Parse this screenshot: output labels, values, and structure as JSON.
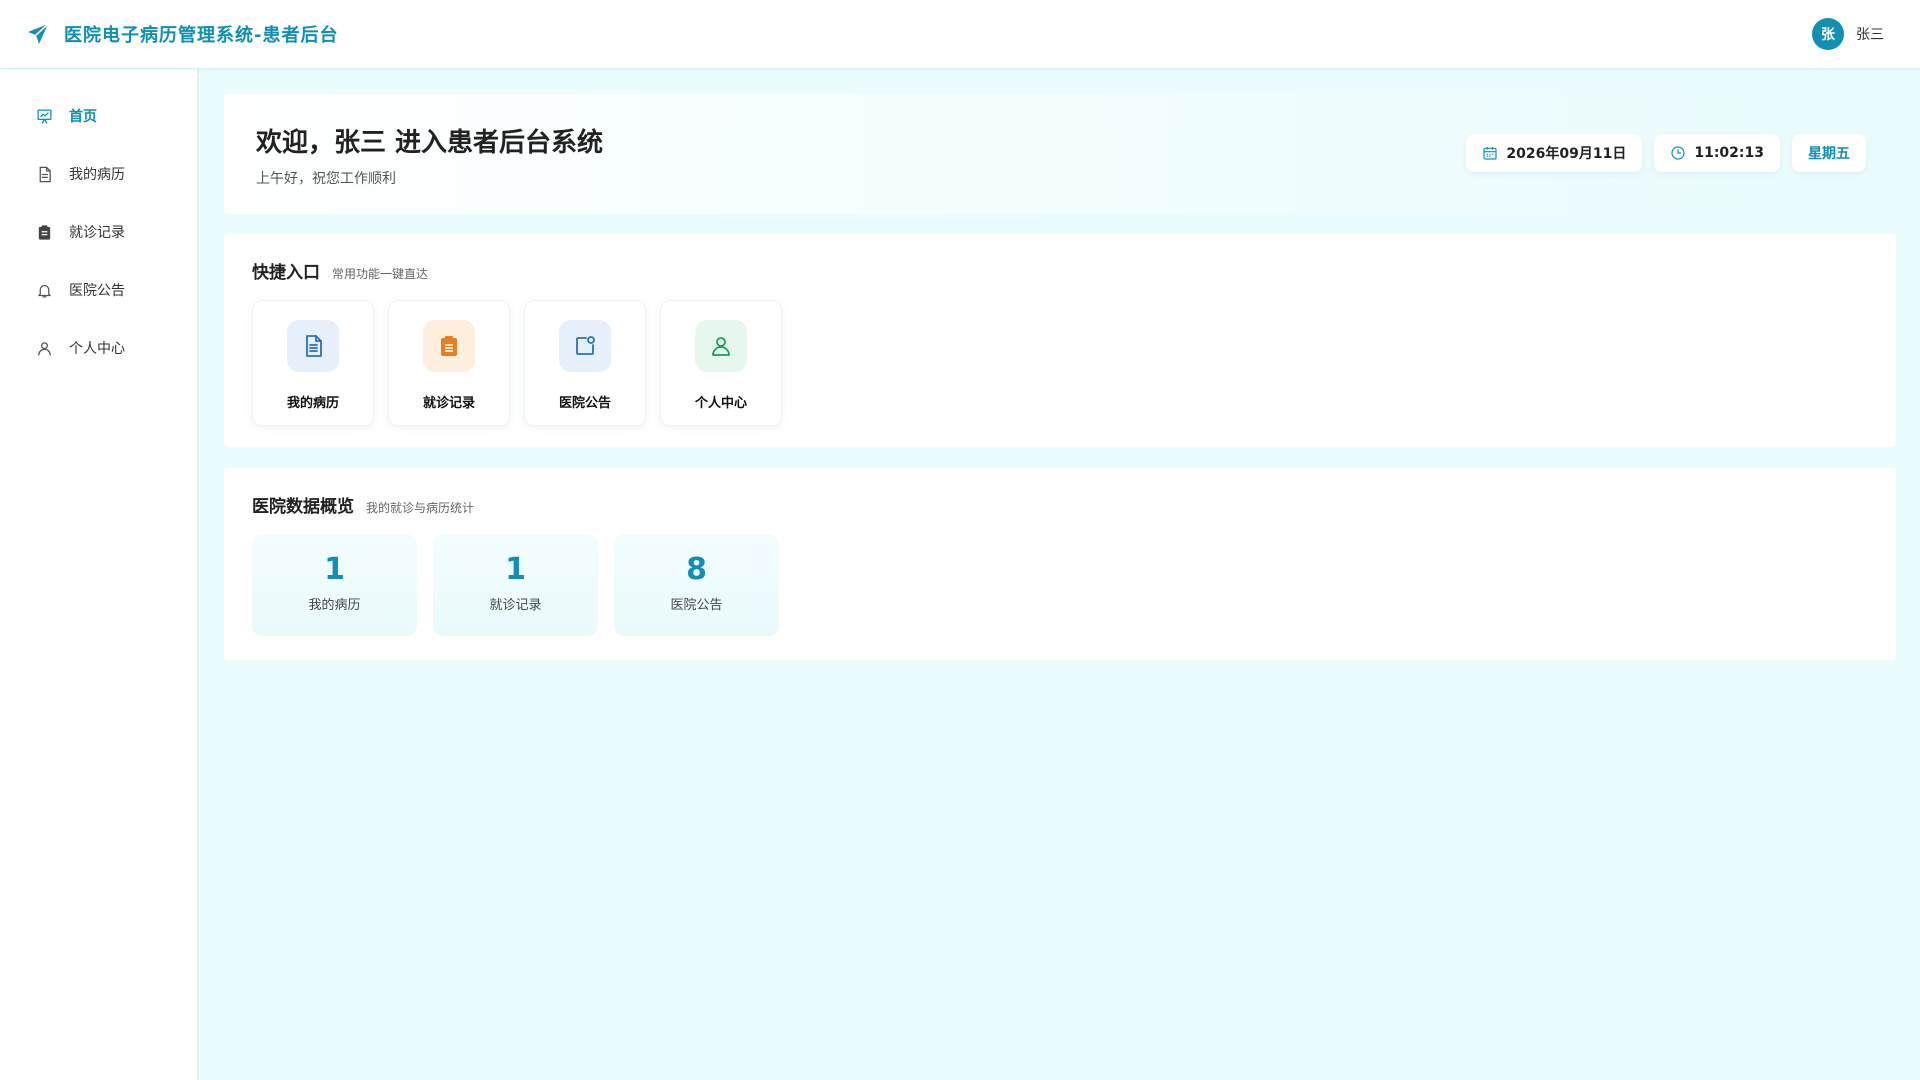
{
  "app": {
    "title": "医院电子病历管理系统-患者后台"
  },
  "user": {
    "avatar_initial": "张",
    "name": "张三"
  },
  "sidebar": {
    "items": [
      {
        "label": "首页",
        "icon": "dashboard-icon",
        "active": true
      },
      {
        "label": "我的病历",
        "icon": "document-icon",
        "active": false
      },
      {
        "label": "就诊记录",
        "icon": "clipboard-icon",
        "active": false
      },
      {
        "label": "医院公告",
        "icon": "bell-icon",
        "active": false
      },
      {
        "label": "个人中心",
        "icon": "user-icon",
        "active": false
      }
    ]
  },
  "welcome": {
    "title": "欢迎，张三 进入患者后台系统",
    "subtitle": "上午好，祝您工作顺利",
    "date": "2026年09月11日",
    "time": "11:02:13",
    "weekday": "星期五"
  },
  "quick_access": {
    "title": "快捷入口",
    "subtitle": "常用功能一键直达",
    "items": [
      {
        "label": "我的病历",
        "icon": "document-icon",
        "color": "#2f6fb5"
      },
      {
        "label": "就诊记录",
        "icon": "clipboard-icon",
        "color": "#e8801f"
      },
      {
        "label": "医院公告",
        "icon": "notice-icon",
        "color": "#2f6fb5"
      },
      {
        "label": "个人中心",
        "icon": "user-icon",
        "color": "#1a9e5a"
      }
    ]
  },
  "overview": {
    "title": "医院数据概览",
    "subtitle": "我的就诊与病历统计",
    "stats": [
      {
        "value": "1",
        "label": "我的病历"
      },
      {
        "value": "1",
        "label": "就诊记录"
      },
      {
        "value": "8",
        "label": "医院公告"
      }
    ]
  },
  "colors": {
    "accent": "#0f8fb3",
    "background": "#eafcfe"
  }
}
